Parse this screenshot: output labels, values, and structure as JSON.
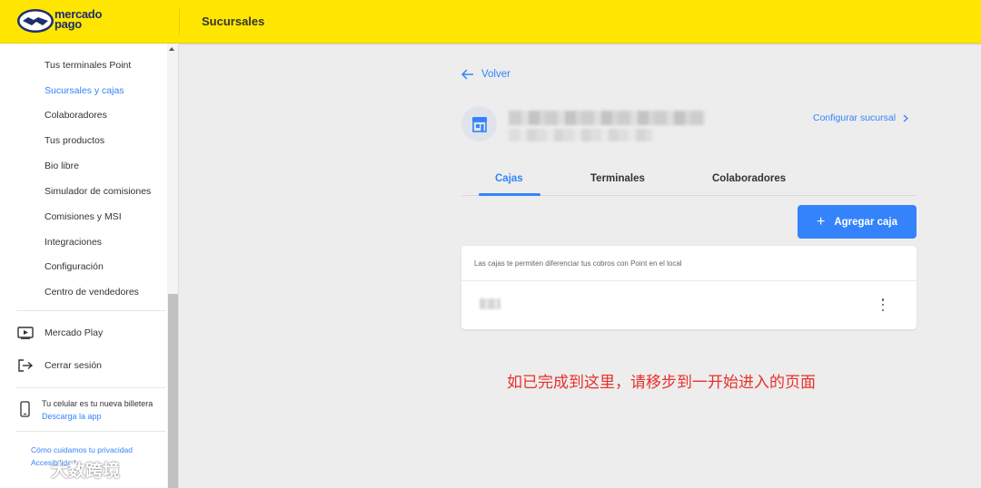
{
  "header": {
    "logo_line1": "mercado",
    "logo_line2": "pago",
    "title": "Sucursales"
  },
  "sidebar": {
    "items": [
      {
        "label": "Tus terminales Point",
        "active": false
      },
      {
        "label": "Sucursales y cajas",
        "active": true
      },
      {
        "label": "Colaboradores",
        "active": false
      },
      {
        "label": "Tus productos",
        "active": false
      },
      {
        "label": "Bio libre",
        "active": false
      },
      {
        "label": "Simulador de comisiones",
        "active": false
      },
      {
        "label": "Comisiones y MSI",
        "active": false
      },
      {
        "label": "Integraciones",
        "active": false
      },
      {
        "label": "Configuración",
        "active": false
      },
      {
        "label": "Centro de vendedores",
        "active": false
      }
    ],
    "mercado_play": {
      "label": "Mercado Play",
      "icon": "play-screen-icon"
    },
    "logout": {
      "label": "Cerrar sesión",
      "icon": "logout-icon"
    },
    "wallet": {
      "title": "Tu celular es tu nueva billetera",
      "link": "Descarga la app",
      "icon": "phone-icon"
    },
    "privacy_link": "Cómo cuidamos tu privacidad",
    "accessibility_link": "Accesibilidad"
  },
  "main": {
    "back_label": "Volver",
    "configure_label": "Configurar sucursal",
    "tabs": [
      {
        "label": "Cajas",
        "active": true
      },
      {
        "label": "Terminales",
        "active": false
      },
      {
        "label": "Colaboradores",
        "active": false
      }
    ],
    "add_button_label": "Agregar caja",
    "card_info": "Las cajas te permiten diferenciar tus cobros con Point en el local"
  },
  "notice": "如已完成到这里，请移步到一开始进入的页面",
  "watermark": "大数跨境",
  "colors": {
    "header_bg": "#ffe600",
    "accent": "#3483fa",
    "notice": "#e8312b",
    "page_bg": "#ededed"
  }
}
